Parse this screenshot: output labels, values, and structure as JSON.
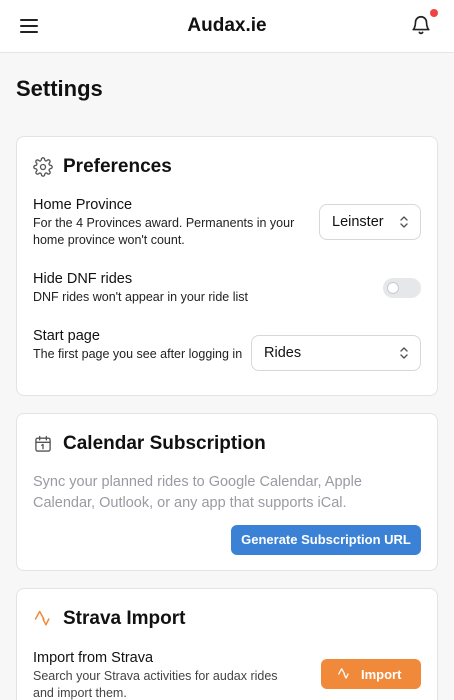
{
  "header": {
    "brand": "Audax.ie",
    "notification_dot_color": "#ef4444"
  },
  "page": {
    "title": "Settings"
  },
  "preferences": {
    "title": "Preferences",
    "icon": "gear-icon",
    "home_province": {
      "label": "Home Province",
      "description": "For the 4 Provinces award. Permanents in your home province won't count.",
      "selected": "Leinster"
    },
    "hide_dnf": {
      "label": "Hide DNF rides",
      "description": "DNF rides won't appear in your ride list",
      "enabled": false
    },
    "start_page": {
      "label": "Start page",
      "description": "The first page you see after logging in",
      "selected": "Rides"
    }
  },
  "calendar": {
    "title": "Calendar Subscription",
    "icon": "calendar-icon",
    "description": "Sync your planned rides to Google Calendar, Apple Calendar, Outlook, or any app that supports iCal.",
    "button_label": "Generate Subscription URL",
    "button_color": "#3b82d6"
  },
  "strava": {
    "title": "Strava Import",
    "icon": "strava-icon",
    "import_label": "Import from Strava",
    "import_description": "Search your Strava activities for audax rides and import them.",
    "button_label": "Import",
    "accent_color": "#f08a3a"
  }
}
